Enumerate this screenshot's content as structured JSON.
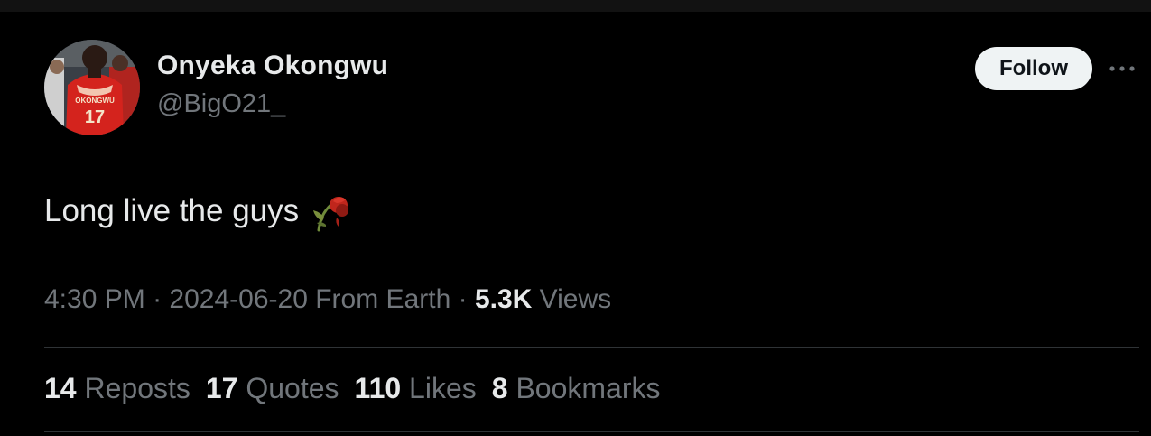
{
  "author": {
    "name": "Onyeka Okongwu",
    "handle": "@BigO21_",
    "avatar_jersey_text": "OKONGWU",
    "avatar_jersey_number": "17"
  },
  "follow_label": "Follow",
  "more_icon": "more-horizontal-icon",
  "tweet": {
    "text": "Long live the guys",
    "emoji": "wilted-flower-icon"
  },
  "meta": {
    "time": "4:30 PM",
    "separator": "·",
    "date": "2024-06-20",
    "source": "From Earth",
    "views_count": "5.3K",
    "views_label": "Views"
  },
  "stats": [
    {
      "count": "14",
      "label": "Reposts"
    },
    {
      "count": "17",
      "label": "Quotes"
    },
    {
      "count": "110",
      "label": "Likes"
    },
    {
      "count": "8",
      "label": "Bookmarks"
    }
  ],
  "colors": {
    "background": "#000000",
    "primary_text": "#e7e9ea",
    "secondary_text": "#71767b",
    "divider": "#2f3336",
    "follow_bg": "#eff3f4",
    "follow_text": "#0f1419"
  }
}
